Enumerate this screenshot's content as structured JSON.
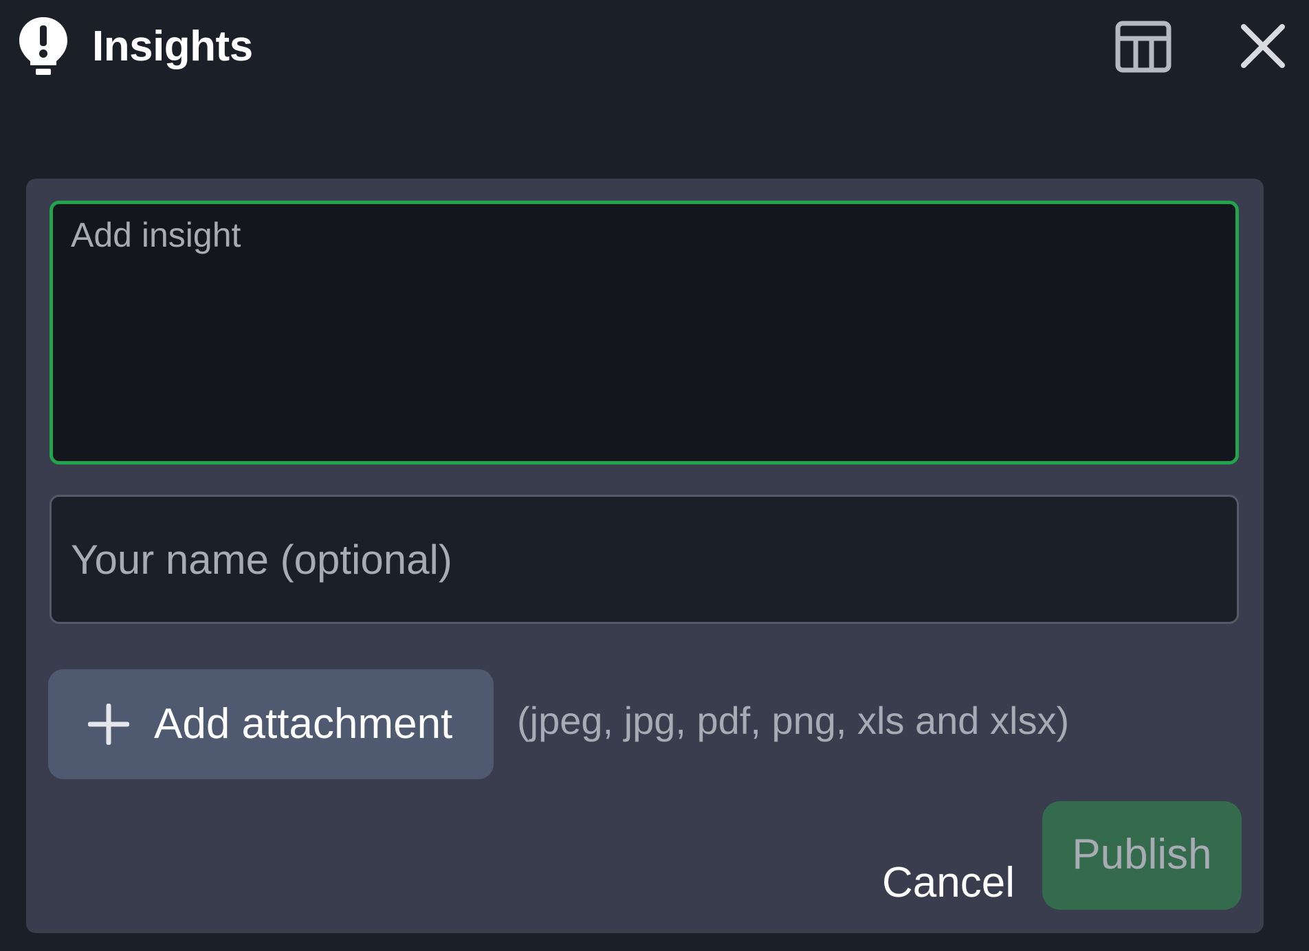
{
  "header": {
    "title": "Insights",
    "icon": "lightbulb-icon",
    "layout_icon": "layout-table-icon",
    "close_icon": "close-icon"
  },
  "form": {
    "insight": {
      "placeholder": "Add insight",
      "value": ""
    },
    "name": {
      "placeholder": "Your name (optional)",
      "value": ""
    },
    "attachment": {
      "button_label": "Add attachment",
      "button_icon": "plus-icon",
      "allowed_types": "(jpeg, jpg, pdf, png, xls and xlsx)"
    },
    "actions": {
      "cancel_label": "Cancel",
      "publish_label": "Publish"
    }
  },
  "colors": {
    "background": "#1b1f28",
    "card": "#393d4d",
    "focus_border": "#22a34c",
    "attach_button": "#4f5a70",
    "publish_button": "#346b4d",
    "muted_text": "#a8abb3"
  }
}
